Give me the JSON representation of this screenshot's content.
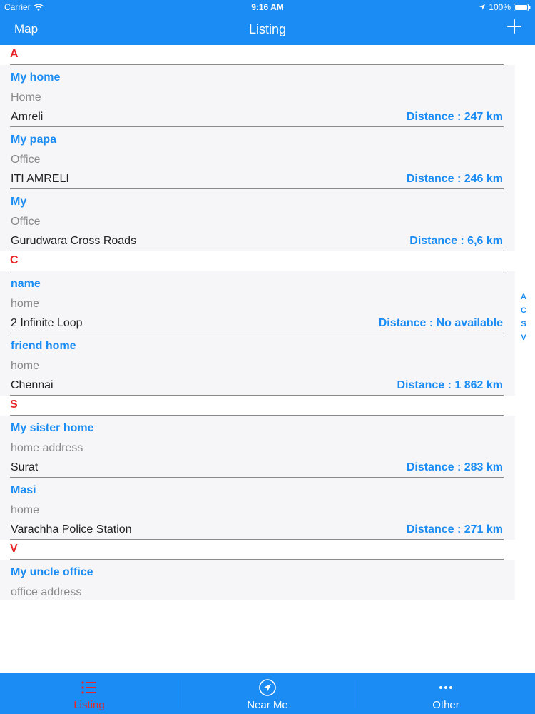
{
  "status": {
    "carrier": "Carrier",
    "time": "9:16 AM",
    "battery": "100%"
  },
  "nav": {
    "left": "Map",
    "title": "Listing"
  },
  "sections": [
    {
      "letter": "A",
      "items": [
        {
          "title": "My home",
          "type": "Home",
          "address": "Amreli",
          "distance": "Distance : 247 km"
        },
        {
          "title": "My papa",
          "type": "Office",
          "address": "ITI AMRELI",
          "distance": "Distance : 246 km"
        },
        {
          "title": "My",
          "type": "Office",
          "address": "Gurudwara Cross Roads",
          "distance": "Distance : 6,6 km"
        }
      ]
    },
    {
      "letter": "C",
      "items": [
        {
          "title": "name",
          "type": "home",
          "address": "2 Infinite Loop",
          "distance": "Distance : No available"
        },
        {
          "title": "friend home",
          "type": "home",
          "address": "Chennai",
          "distance": "Distance : 1 862 km"
        }
      ]
    },
    {
      "letter": "S",
      "items": [
        {
          "title": "My sister home",
          "type": "home address",
          "address": "Surat",
          "distance": "Distance : 283 km"
        },
        {
          "title": "Masi",
          "type": "home",
          "address": "Varachha Police Station",
          "distance": "Distance : 271 km"
        }
      ]
    },
    {
      "letter": "V",
      "items": [
        {
          "title": "My uncle office",
          "type": "office address"
        }
      ]
    }
  ],
  "index": [
    "A",
    "C",
    "S",
    "V"
  ],
  "tabs": [
    {
      "label": "Listing",
      "active": true
    },
    {
      "label": "Near Me",
      "active": false
    },
    {
      "label": "Other",
      "active": false
    }
  ],
  "colors": {
    "accent": "#1a8cf3",
    "section": "#e8262a"
  }
}
